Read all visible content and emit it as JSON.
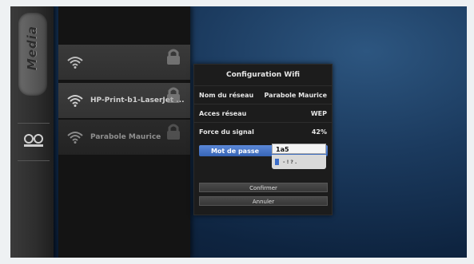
{
  "rail": {
    "label": "Media",
    "icons": [
      "media-tab",
      "settings-icon"
    ]
  },
  "networks": [
    {
      "name": "",
      "icon": "wifi-icon",
      "secured": true
    },
    {
      "name": "HP-Print-b1-LaserJet ...",
      "icon": "wifi-icon",
      "secured": true
    },
    {
      "name": "Parabole Maurice",
      "icon": "wifi-icon",
      "secured": true
    }
  ],
  "dialog": {
    "title": "Configuration Wifi",
    "rows": [
      {
        "label": "Nom du réseau",
        "value": "Parabole Maurice"
      },
      {
        "label": "Acces réseau",
        "value": "WEP"
      },
      {
        "label": "Force du signal",
        "value": "42%"
      }
    ],
    "password_label": "Mot de passe",
    "password_value": "1a5",
    "keypad_hint": "- ! ? .",
    "confirm_label": "Confirmer",
    "cancel_label": "Annuler"
  },
  "colors": {
    "accent": "#4a78cc",
    "background": "#1b3a5e"
  }
}
